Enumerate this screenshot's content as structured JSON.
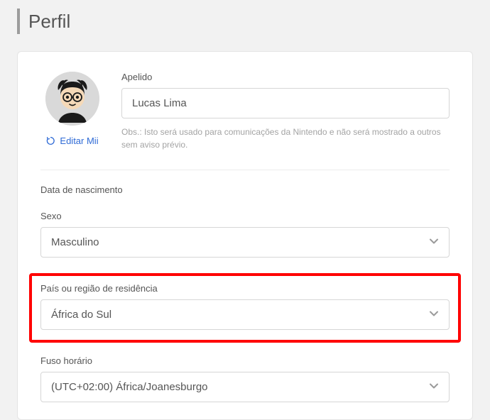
{
  "page": {
    "title": "Perfil"
  },
  "avatar": {
    "edit_label": "Editar Mii"
  },
  "nickname": {
    "label": "Apelido",
    "value": "Lucas Lima",
    "hint": "Obs.: Isto será usado para comunicações da Nintendo e não será mostrado a outros sem aviso prévio."
  },
  "birthdate": {
    "label": "Data de nascimento"
  },
  "gender": {
    "label": "Sexo",
    "value": "Masculino"
  },
  "country": {
    "label": "País ou região de residência",
    "value": "África do Sul"
  },
  "timezone": {
    "label": "Fuso horário",
    "value": "(UTC+02:00) África/Joanesburgo"
  }
}
